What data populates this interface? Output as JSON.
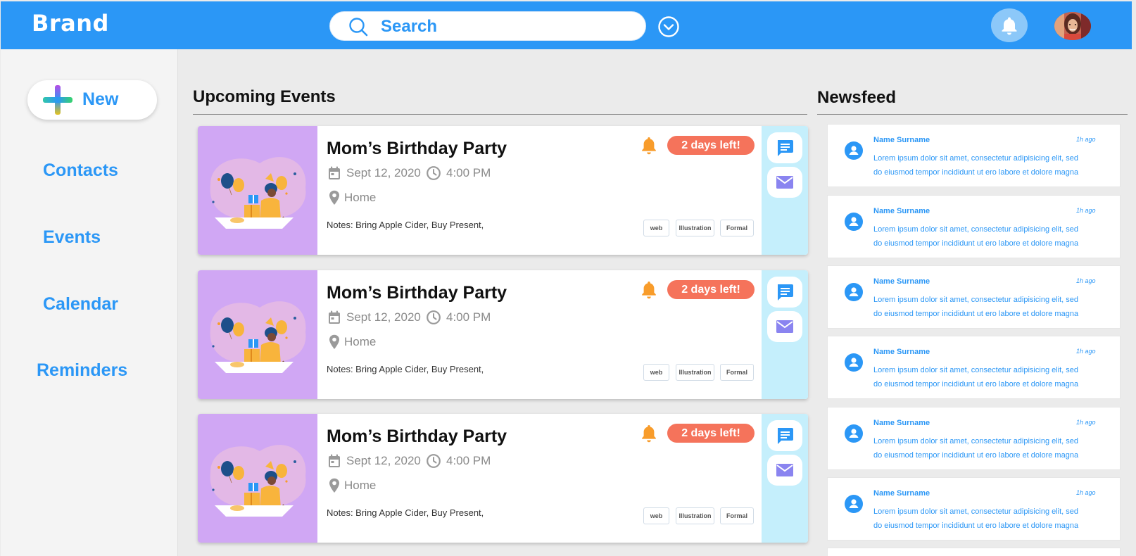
{
  "header": {
    "brand": "Brand",
    "search_placeholder": "Search"
  },
  "sidebar": {
    "new_label": "New",
    "items": [
      {
        "label": "Contacts"
      },
      {
        "label": "Events"
      },
      {
        "label": "Calendar"
      },
      {
        "label": "Reminders"
      }
    ]
  },
  "events_section": {
    "title": "Upcoming Events",
    "cards": [
      {
        "title": "Mom’s Birthday Party",
        "date": "Sept 12, 2020",
        "time": "4:00 PM",
        "location": "Home",
        "notes": "Notes: Bring Apple Cider, Buy Present,",
        "badge": "2 days left!",
        "tags": [
          "web",
          "Illustration",
          "Formal"
        ]
      },
      {
        "title": "Mom’s Birthday Party",
        "date": "Sept 12, 2020",
        "time": "4:00 PM",
        "location": "Home",
        "notes": "Notes: Bring Apple Cider, Buy Present,",
        "badge": "2 days left!",
        "tags": [
          "web",
          "Illustration",
          "Formal"
        ]
      },
      {
        "title": "Mom’s Birthday Party",
        "date": "Sept 12, 2020",
        "time": "4:00 PM",
        "location": "Home",
        "notes": "Notes: Bring Apple Cider, Buy Present,",
        "badge": "2 days left!",
        "tags": [
          "web",
          "Illustration",
          "Formal"
        ]
      }
    ]
  },
  "newsfeed": {
    "title": "Newsfeed",
    "items": [
      {
        "name": "Name Surname",
        "ago": "1h ago",
        "line1": "Lorem ipsum dolor sit amet, consectetur adipisicing elit, sed",
        "line2": "do eiusmod tempor incididunt ut ero labore et dolore magna"
      },
      {
        "name": "Name Surname",
        "ago": "1h ago",
        "line1": "Lorem ipsum dolor sit amet, consectetur adipisicing elit, sed",
        "line2": "do eiusmod tempor incididunt ut ero labore et dolore magna"
      },
      {
        "name": "Name Surname",
        "ago": "1h ago",
        "line1": "Lorem ipsum dolor sit amet, consectetur adipisicing elit, sed",
        "line2": "do eiusmod tempor incididunt ut ero labore et dolore magna"
      },
      {
        "name": "Name Surname",
        "ago": "1h ago",
        "line1": "Lorem ipsum dolor sit amet, consectetur adipisicing elit, sed",
        "line2": "do eiusmod tempor incididunt ut ero labore et dolore magna"
      },
      {
        "name": "Name Surname",
        "ago": "1h ago",
        "line1": "Lorem ipsum dolor sit amet, consectetur adipisicing elit, sed",
        "line2": "do eiusmod tempor incididunt ut ero labore et dolore magna"
      },
      {
        "name": "Name Surname",
        "ago": "1h ago",
        "line1": "Lorem ipsum dolor sit amet, consectetur adipisicing elit, sed",
        "line2": "do eiusmod tempor incididunt ut ero labore et dolore magna"
      }
    ]
  },
  "icons": {
    "search": "search-icon",
    "dropdown": "chevron-down-circle-icon",
    "notifications": "bell-icon",
    "new": "plus-icon",
    "calendar": "calendar-icon",
    "clock": "clock-icon",
    "location": "location-pin-icon",
    "alarm": "bell-icon",
    "chat": "chat-icon",
    "mail": "mail-icon",
    "user": "user-icon"
  },
  "colors": {
    "primary": "#2b97f6",
    "badge": "#f5735b",
    "alarm": "#f89c2b",
    "thumb_bg": "#d0a7f4",
    "actions_bg": "#c5effc",
    "mail": "#8a84f0"
  }
}
